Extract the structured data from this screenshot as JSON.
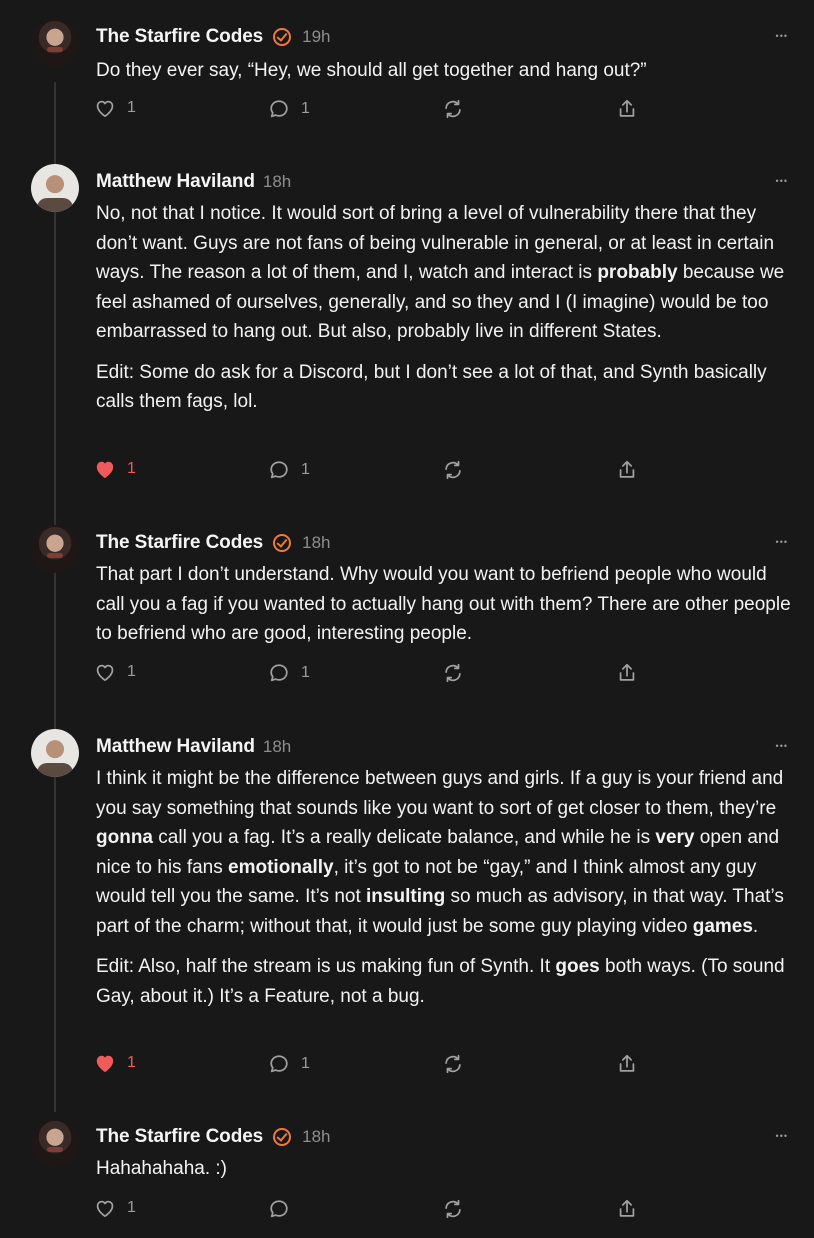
{
  "accent": "#f2783a",
  "like_color": "#ef5a5a",
  "comments": [
    {
      "author": "The Starfire Codes",
      "verified": true,
      "time": "19h",
      "avatar": "starfire-avatar",
      "paragraphs": [
        "Do they ever say, “Hey, we should all get together and hang out?”"
      ],
      "likes": "1",
      "liked": false,
      "replies": "1"
    },
    {
      "author": "Matthew Haviland",
      "verified": false,
      "time": "18h",
      "avatar": "matthew-avatar",
      "paragraphs": [
        "No, not that I notice. It would sort of bring a level of vulnerability there that they don’t want. Guys are not fans of being vulnerable in general, or at least in certain ways. The reason a lot of them, and I, watch and interact is **probably** because we feel ashamed of ourselves, generally, and so they and I (I imagine) would be too embarrassed to hang out. But also, probably live in different States.",
        "Edit: Some do ask for a Discord, but I don’t see a lot of that, and Synth basically calls them fags, lol."
      ],
      "likes": "1",
      "liked": true,
      "replies": "1"
    },
    {
      "author": "The Starfire Codes",
      "verified": true,
      "time": "18h",
      "avatar": "starfire-avatar",
      "paragraphs": [
        "That part I don’t understand. Why would you want to befriend people who would call you a fag if you wanted to actually hang out with them? There are other people to befriend who are good, interesting people."
      ],
      "likes": "1",
      "liked": false,
      "replies": "1"
    },
    {
      "author": "Matthew Haviland",
      "verified": false,
      "time": "18h",
      "avatar": "matthew-avatar",
      "paragraphs": [
        "I think it might be the difference between guys and girls. If a guy is your friend and you say something that sounds like you want to sort of get closer to them, they’re **gonna** call you a fag. It’s a really delicate balance, and while he is **very** open and nice to his fans **emotionally**, it’s got to not be “gay,” and I think almost any guy would tell you the same. It’s not **insulting** so much as advisory, in that way. That’s part of the charm; without that, it would just be some guy playing video **games**.",
        "Edit: Also, half the stream is us making fun of Synth. It **goes** both ways. (To sound Gay, about it.) It’s a Feature, not a bug."
      ],
      "likes": "1",
      "liked": true,
      "replies": "1"
    },
    {
      "author": "The Starfire Codes",
      "verified": true,
      "time": "18h",
      "avatar": "starfire-avatar",
      "paragraphs": [
        "Hahahahaha. :)"
      ],
      "likes": "1",
      "liked": false,
      "replies": ""
    }
  ]
}
